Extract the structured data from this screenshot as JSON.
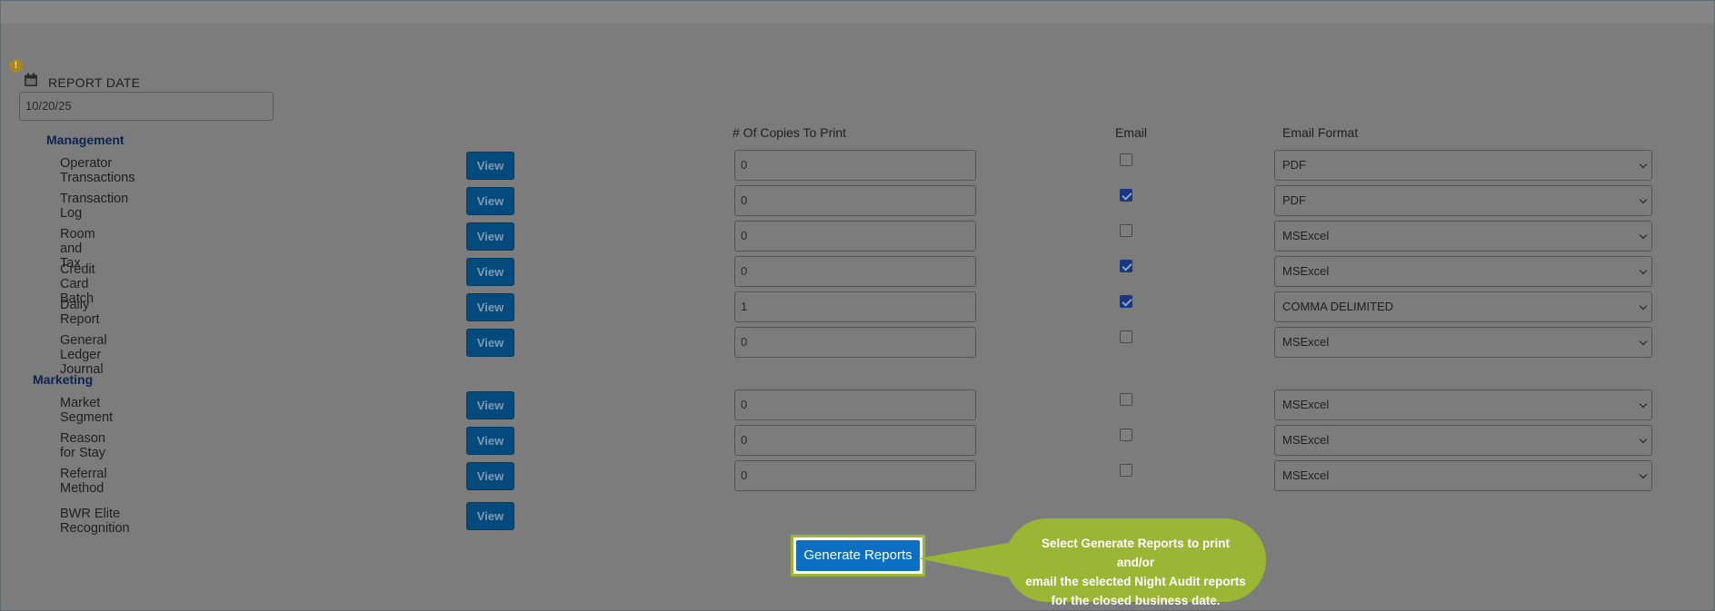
{
  "report_date": {
    "label": "REPORT DATE",
    "value": "10/20/25"
  },
  "columns": {
    "copies": "# Of Copies To Print",
    "email": "Email",
    "format": "Email Format"
  },
  "sections": [
    {
      "title": "Management",
      "reports": [
        {
          "name": "Operator Transactions",
          "view": "View",
          "copies": "0",
          "email": false,
          "format": "PDF"
        },
        {
          "name": "Transaction Log",
          "view": "View",
          "copies": "0",
          "email": true,
          "format": "PDF"
        },
        {
          "name": "Room and Tax",
          "view": "View",
          "copies": "0",
          "email": false,
          "format": "MSExcel"
        },
        {
          "name": "Credit Card Batch",
          "view": "View",
          "copies": "0",
          "email": true,
          "format": "MSExcel"
        },
        {
          "name": "Daily Report",
          "view": "View",
          "copies": "1",
          "email": true,
          "format": "COMMA DELIMITED"
        },
        {
          "name": "General Ledger Journal",
          "view": "View",
          "copies": "0",
          "email": false,
          "format": "MSExcel"
        }
      ]
    },
    {
      "title": "Marketing",
      "reports": [
        {
          "name": "Market Segment",
          "view": "View",
          "copies": "0",
          "email": false,
          "format": "MSExcel"
        },
        {
          "name": "Reason for Stay",
          "view": "View",
          "copies": "0",
          "email": false,
          "format": "MSExcel"
        },
        {
          "name": "Referral Method",
          "view": "View",
          "copies": "0",
          "email": false,
          "format": "MSExcel"
        },
        {
          "name": "BWR Elite Recognition",
          "view": "View"
        }
      ]
    }
  ],
  "generate_button": "Generate Reports",
  "tooltip": {
    "line1": "Select Generate Reports to print and/or",
    "line2": "email the selected Night Audit reports",
    "line3": "for the closed business date."
  },
  "icons": {
    "info": "info-icon",
    "calendar": "calendar-icon",
    "dropdown": "chevron-down-icon"
  },
  "colors": {
    "accent_green": "#9bb534",
    "button_blue": "#0c6fc1",
    "view_button": "#054a7c"
  }
}
